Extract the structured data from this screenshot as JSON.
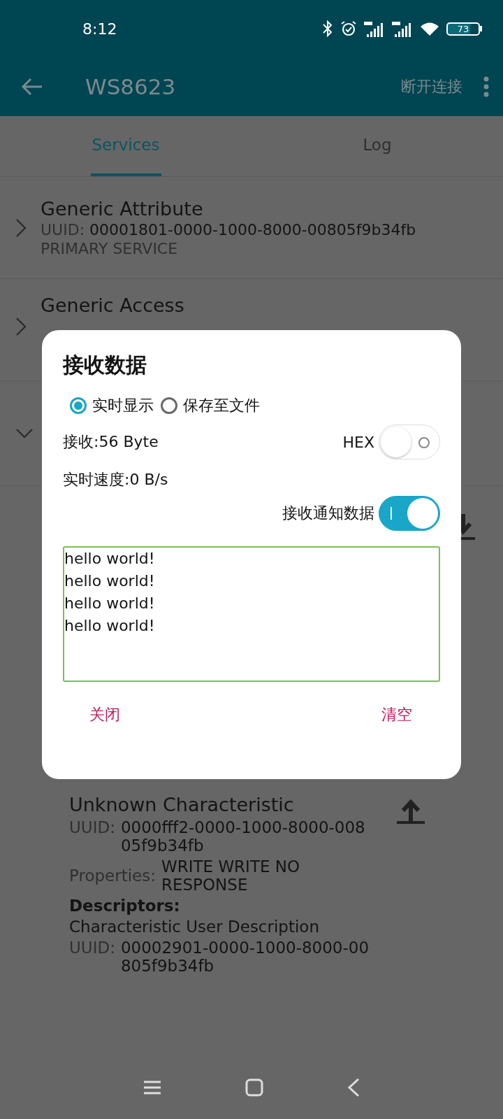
{
  "status_bar": {
    "time": "8:12",
    "battery": "73"
  },
  "toolbar": {
    "title": "WS8623",
    "action": "断开连接"
  },
  "tabs": [
    {
      "label": "Services",
      "selected": true
    },
    {
      "label": "Log",
      "selected": false
    }
  ],
  "services": [
    {
      "name": "Generic Attribute",
      "uuid_label": "UUID:",
      "uuid": "00001801-0000-1000-8000-00805f9b34fb",
      "type": "PRIMARY SERVICE",
      "expanded": false
    },
    {
      "name": "Generic Access",
      "expanded": false
    },
    {
      "expanded": true
    }
  ],
  "characteristic": {
    "name": "Unknown Characteristic",
    "uuid_label": "UUID:",
    "uuid": "0000fff2-0000-1000-8000-00805f9b34fb",
    "properties_label": "Properties:",
    "properties": "WRITE WRITE NO RESPONSE",
    "descriptors_label": "Descriptors:",
    "descriptors": [
      {
        "name": "Characteristic User Description",
        "uuid_label": "UUID:",
        "uuid": "00002901-0000-1000-8000-00805f9b34fb"
      }
    ]
  },
  "dialog": {
    "title": "接收数据",
    "modes": [
      {
        "label": "实时显示",
        "selected": true
      },
      {
        "label": "保存至文件",
        "selected": false
      }
    ],
    "received": "接收:56 Byte",
    "hex": {
      "label": "HEX",
      "on": false
    },
    "speed": "实时速度:0 B/s",
    "notify": {
      "label": "接收通知数据",
      "on": true
    },
    "output": "hello world!\nhello world!\nhello world!\nhello world!",
    "buttons": [
      "关闭",
      "清空"
    ]
  }
}
